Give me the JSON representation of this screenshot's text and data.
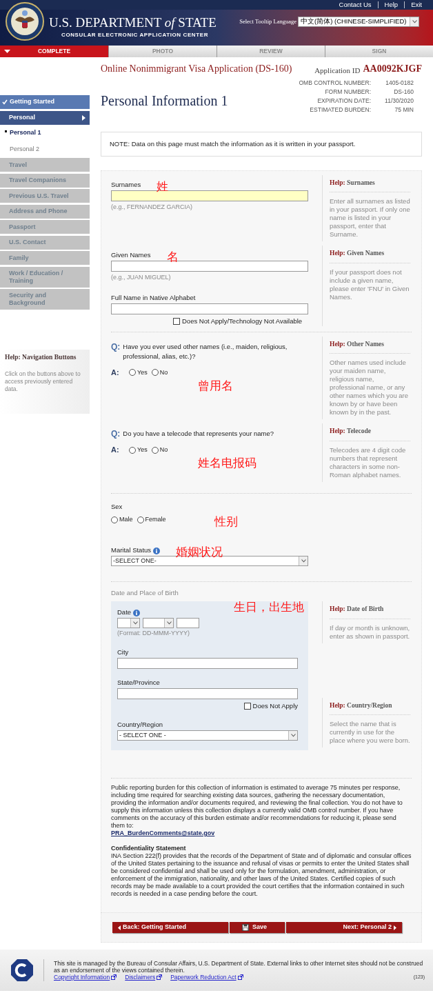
{
  "header": {
    "links": [
      "Contact Us",
      "Help",
      "Exit"
    ],
    "title": "U.S. DEPARTMENT *of* STATE",
    "subtitle": "CONSULAR ELECTRONIC APPLICATION CENTER",
    "language_label": "Select Tooltip Language",
    "language_value": "中文(简体)  (CHINESE-SIMPLIFIED)"
  },
  "steps": [
    {
      "label": "COMPLETE",
      "selected": true
    },
    {
      "label": "PHOTO",
      "selected": false
    },
    {
      "label": "REVIEW",
      "selected": false
    },
    {
      "label": "SIGN",
      "selected": false
    }
  ],
  "sidebar": {
    "items": [
      {
        "label": "Getting Started",
        "kind": "completed",
        "selected": false
      },
      {
        "label": "Personal",
        "kind": "active",
        "selected": false
      },
      {
        "label": "Personal 1",
        "kind": "subpage",
        "selected": true
      },
      {
        "label": "Personal 2",
        "kind": "subpage",
        "selected": false
      },
      {
        "label": "Travel",
        "kind": "section",
        "selected": false
      },
      {
        "label": "Travel Companions",
        "kind": "section",
        "selected": false
      },
      {
        "label": "Previous U.S. Travel",
        "kind": "section",
        "selected": false
      },
      {
        "label": "Address and Phone",
        "kind": "section",
        "selected": false
      },
      {
        "label": "Passport",
        "kind": "section",
        "selected": false
      },
      {
        "label": "U.S. Contact",
        "kind": "section",
        "selected": false
      },
      {
        "label": "Family",
        "kind": "section",
        "selected": false
      },
      {
        "label": "Work / Education / Training",
        "kind": "section",
        "selected": false
      },
      {
        "label": "Security and Background",
        "kind": "section",
        "selected": false
      }
    ],
    "help": {
      "label": "Help:",
      "title": "Navigation Buttons",
      "text": "Click on the buttons above to access previously entered data."
    }
  },
  "app_title": "Online Nonimmigrant Visa Application (DS-160)",
  "application_id_label": "Application ID",
  "application_id": "AA0092KJGF",
  "page_title": "Personal Information 1",
  "meta": [
    {
      "label": "OMB CONTROL NUMBER:",
      "value": "1405-0182"
    },
    {
      "label": "FORM NUMBER:",
      "value": "DS-160"
    },
    {
      "label": "EXPIRATION DATE:",
      "value": "11/30/2020"
    },
    {
      "label": "ESTIMATED BURDEN:",
      "value": "75 MIN"
    }
  ],
  "note": "NOTE: Data on this page must match the information as it is written in your passport.",
  "sections": [
    {
      "kind": "fields",
      "blocks": [
        {
          "fields": [
            {
              "kind": "text",
              "label": "Surnames",
              "focused": true,
              "hint": "(e.g., FERNANDEZ GARCIA)",
              "annotation": "姓"
            }
          ],
          "help": {
            "label": "Help:",
            "title": "Surnames",
            "text": "Enter all surnames as listed in your passport. If only one name is listed in your passport, enter that Surname."
          }
        },
        {
          "fields": [
            {
              "kind": "text",
              "label": "Given Names",
              "focused": false,
              "hint": "(e.g., JUAN MIGUEL)",
              "annotation": "名"
            },
            {
              "kind": "text",
              "label": "Full Name in Native Alphabet",
              "focused": false,
              "checkbox": {
                "label": "Does Not Apply/Technology Not Available",
                "checked": false
              }
            }
          ],
          "help": {
            "label": "Help:",
            "title": "Given Names",
            "text": "If your passport does not include a given name, please enter 'FNU' in Given Names."
          }
        }
      ]
    },
    {
      "kind": "fields",
      "blocks": [
        {
          "fields": [
            {
              "kind": "question",
              "q_mark": "Q:",
              "question": "Have you ever used other names (i.e., maiden, religious, professional, alias, etc.)?",
              "a_mark": "A:",
              "options": [
                {
                  "label": "Yes",
                  "selected": false
                },
                {
                  "label": "No",
                  "selected": false
                }
              ],
              "annotation": "曾用名"
            }
          ],
          "help": {
            "label": "Help:",
            "title": "Other Names",
            "text": "Other names used include your maiden name, religious name, professional name, or any other names which you are known by or have been known by in the past."
          }
        },
        {
          "fields": [
            {
              "kind": "question",
              "q_mark": "Q:",
              "question": "Do you have a telecode that represents your name?",
              "a_mark": "A:",
              "options": [
                {
                  "label": "Yes",
                  "selected": false
                },
                {
                  "label": "No",
                  "selected": false
                }
              ],
              "annotation": "姓名电报码"
            }
          ],
          "help": {
            "label": "Help:",
            "title": "Telecode",
            "text": "Telecodes are 4 digit code numbers that represent characters in some non-Roman alphabet names."
          }
        }
      ]
    },
    {
      "kind": "fields",
      "blocks": [
        {
          "fields": [
            {
              "kind": "radio",
              "label": "Sex",
              "options": [
                {
                  "label": "Male",
                  "selected": false
                },
                {
                  "label": "Female",
                  "selected": false
                }
              ],
              "annotation": "性别"
            },
            {
              "kind": "select",
              "label": "Marital Status",
              "info": true,
              "value": "-SELECT ONE-",
              "annotation": "婚姻状况"
            }
          ]
        }
      ]
    },
    {
      "kind": "panel",
      "title": "Date and Place of Birth",
      "annotation": "生日，出生地",
      "fields": [
        {
          "kind": "date",
          "label": "Date",
          "info": true,
          "hint": "(Format: DD-MMM-YYYY)"
        },
        {
          "kind": "text",
          "label": "City",
          "focused": false
        },
        {
          "kind": "text",
          "label": "State/Province",
          "focused": false,
          "checkbox": {
            "label": "Does Not Apply",
            "checked": false
          }
        },
        {
          "kind": "select",
          "label": "Country/Region",
          "value": "- SELECT ONE -"
        }
      ],
      "helps": [
        {
          "label": "Help:",
          "title": "Date of Birth",
          "text": "If day or month is unknown, enter as shown in passport."
        },
        {
          "label": "Help:",
          "title": "Country/Region",
          "text": "Select the name that is currently in use for the place where you were born."
        }
      ]
    }
  ],
  "disclosure": {
    "text": "Public reporting burden for this collection of information is estimated to average 75 minutes per response, including time required for searching existing data sources, gathering the necessary documentation, providing the information and/or documents required, and reviewing the final collection. You do not have to supply this information unless this collection displays a currently valid OMB control number. If you have comments on the accuracy of this burden estimate and/or recommendations for reducing it, please send them to:",
    "email": "PRA_BurdenComments@state.gov",
    "title": "Confidentiality Statement",
    "statement": "INA Section 222(f) provides that the records of the Department of State and of diplomatic and consular offices of the United States pertaining to the issuance and refusal of visas or permits to enter the United States shall be considered confidential and shall be used only for the formulation, amendment, administration, or enforcement of the immigration, nationality, and other laws of the United States. Certified copies of such records may be made available to a court provided the court certifies that the information contained in such records is needed in a case pending before the court."
  },
  "buttons": [
    {
      "kind": "back",
      "label": "Back: Getting Started"
    },
    {
      "kind": "save",
      "label": "Save"
    },
    {
      "kind": "next",
      "label": "Next: Personal 2"
    }
  ],
  "footer": {
    "text": "This site is managed by the Bureau of Consular Affairs, U.S. Department of State. External links to other Internet sites should not be construed as an endorsement of the views contained therein.",
    "links": [
      "Copyright Information",
      "Disclaimers",
      "Paperwork Reduction Act"
    ],
    "code": "(123)"
  }
}
